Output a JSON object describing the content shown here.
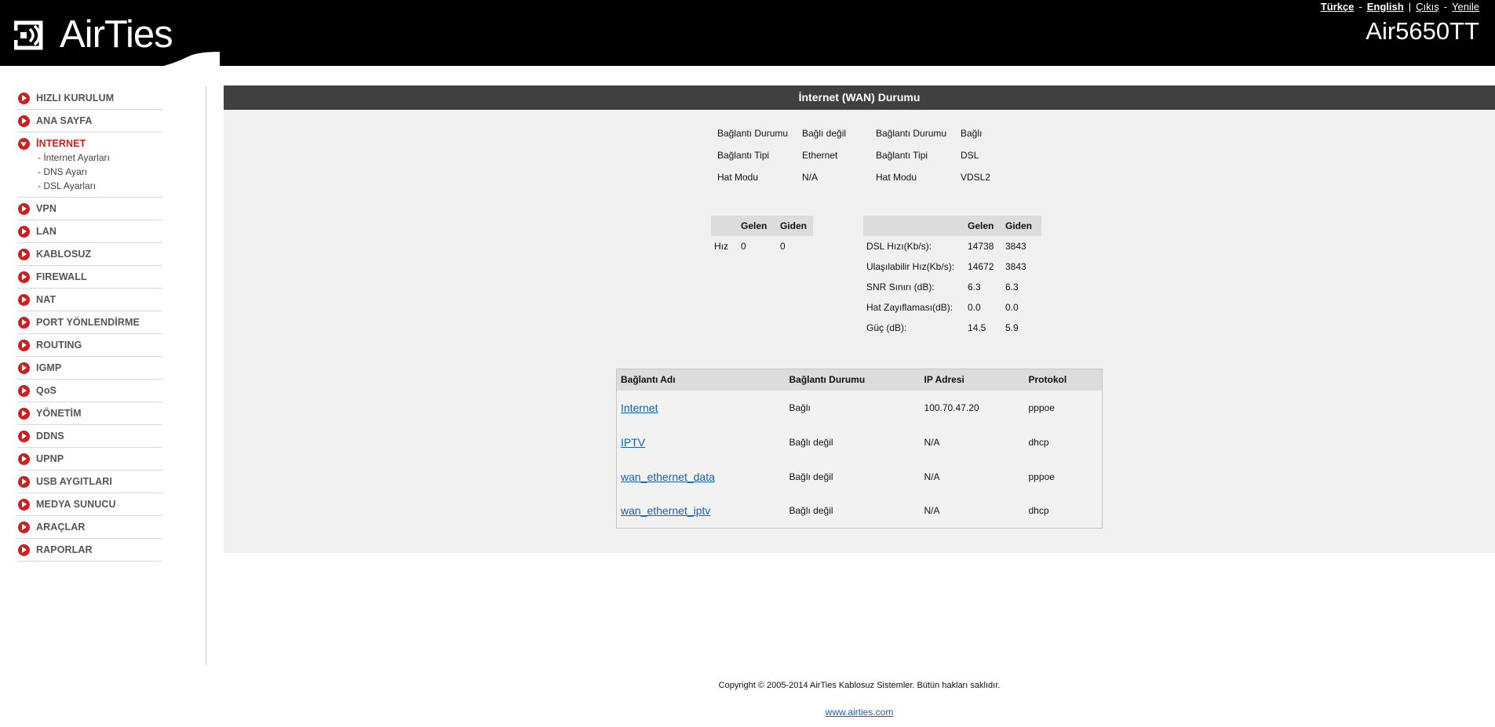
{
  "header": {
    "logo_text": "AirTies",
    "model": "Air5650TT",
    "links": {
      "turkce": "Türkçe",
      "dash1": "-",
      "english": "English",
      "pipe": "|",
      "logout": "Çıkış",
      "dash2": "-",
      "refresh": "Yenile"
    }
  },
  "sidebar": {
    "items": [
      {
        "label": "HIZLI KURULUM"
      },
      {
        "label": "ANA SAYFA"
      },
      {
        "label": "İNTERNET",
        "subitems": [
          "- İnternet Ayarları",
          "- DNS Ayarı",
          "- DSL Ayarları"
        ]
      },
      {
        "label": "VPN"
      },
      {
        "label": "LAN"
      },
      {
        "label": "KABLOSUZ"
      },
      {
        "label": "FIREWALL"
      },
      {
        "label": "NAT"
      },
      {
        "label": "PORT YÖNLENDİRME"
      },
      {
        "label": "ROUTING"
      },
      {
        "label": "IGMP"
      },
      {
        "label": "QoS"
      },
      {
        "label": "YÖNETİM"
      },
      {
        "label": "DDNS"
      },
      {
        "label": "UPNP"
      },
      {
        "label": "USB AYGITLARI"
      },
      {
        "label": "MEDYA SUNUCU"
      },
      {
        "label": "ARAÇLAR"
      },
      {
        "label": "RAPORLAR"
      }
    ]
  },
  "content": {
    "title": "İnternet (WAN) Durumu",
    "ethernet_info": {
      "status_label": "Bağlantı Durumu",
      "status_value": "Bağlı değil",
      "type_label": "Bağlantı Tipi",
      "type_value": "Ethernet",
      "mode_label": "Hat Modu",
      "mode_value": "N/A"
    },
    "dsl_info": {
      "status_label": "Bağlantı Durumu",
      "status_value": "Bağlı",
      "type_label": "Bağlantı Tipi",
      "type_value": "DSL",
      "mode_label": "Hat Modu",
      "mode_value": "VDSL2"
    },
    "eth_stats": {
      "headers": [
        "",
        "Gelen",
        "Giden"
      ],
      "row_label": "Hız",
      "in": "0",
      "out": "0"
    },
    "dsl_stats": {
      "headers": [
        "",
        "Gelen",
        "Giden"
      ],
      "rows": [
        {
          "label": "DSL Hızı(Kb/s):",
          "in": "14738",
          "out": "3843"
        },
        {
          "label": "Ulaşılabilir Hız(Kb/s):",
          "in": "14672",
          "out": "3843"
        },
        {
          "label": "SNR Sınırı (dB):",
          "in": "6.3",
          "out": "6.3"
        },
        {
          "label": "Hat Zayıflaması(dB):",
          "in": "0.0",
          "out": "0.0"
        },
        {
          "label": "Güç (dB):",
          "in": "14.5",
          "out": "5.9"
        }
      ]
    },
    "connections": {
      "headers": [
        "Bağlantı Adı",
        "Bağlantı Durumu",
        "IP Adresi",
        "Protokol"
      ],
      "rows": [
        {
          "name": "Internet",
          "status": "Bağlı",
          "ip": "100.70.47.20",
          "protocol": "pppoe"
        },
        {
          "name": "IPTV",
          "status": "Bağlı değil",
          "ip": "N/A",
          "protocol": "dhcp"
        },
        {
          "name": "wan_ethernet_data",
          "status": "Bağlı değil",
          "ip": "N/A",
          "protocol": "pppoe"
        },
        {
          "name": "wan_ethernet_iptv",
          "status": "Bağlı değil",
          "ip": "N/A",
          "protocol": "dhcp"
        }
      ]
    }
  },
  "footer": {
    "copyright": "Copyright © 2005-2014 AirTies Kablosuz Sistemler. Bütün hakları saklıdır.",
    "website": "www.airties.com"
  }
}
